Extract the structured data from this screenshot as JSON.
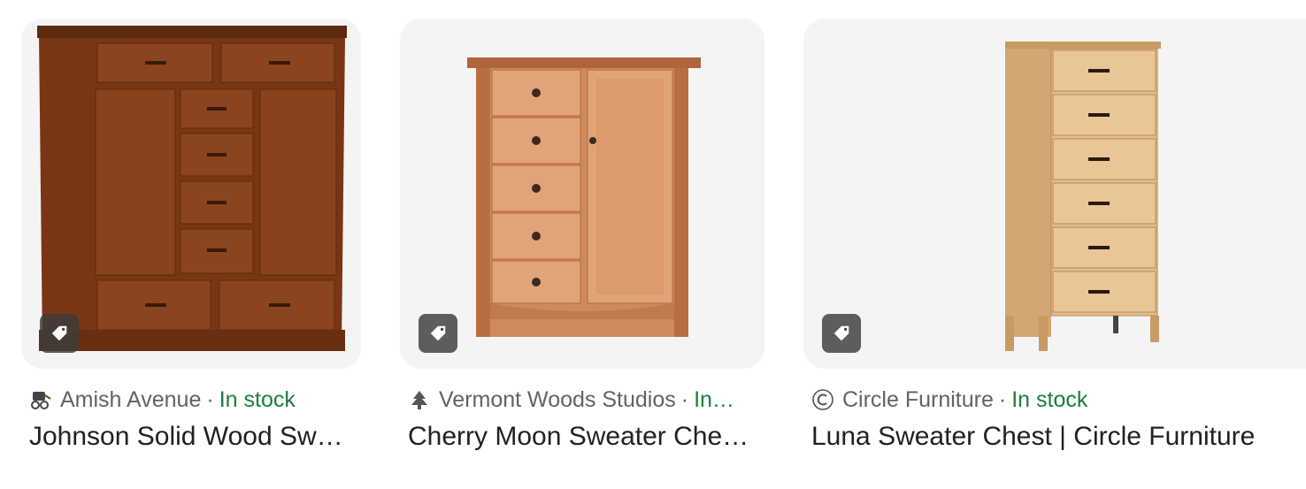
{
  "results": [
    {
      "source": "Amish Avenue",
      "separator": "·",
      "availability": "In stock",
      "title": "Johnson Solid Wood Sw…",
      "favicon": "amish-buggy-icon"
    },
    {
      "source": "Vermont Woods Studios",
      "separator": "·",
      "availability": "In…",
      "title": "Cherry Moon Sweater Che…",
      "favicon": "tree-logo-icon"
    },
    {
      "source": "Circle Furniture",
      "separator": "·",
      "availability": "In stock",
      "title": "Luna Sweater Chest | Circle Furniture",
      "favicon": "circle-c-icon"
    }
  ],
  "colors": {
    "stock_green": "#188038",
    "meta_gray": "#5f6368",
    "title_text": "#202124",
    "card_bg": "#f4f4f4"
  }
}
